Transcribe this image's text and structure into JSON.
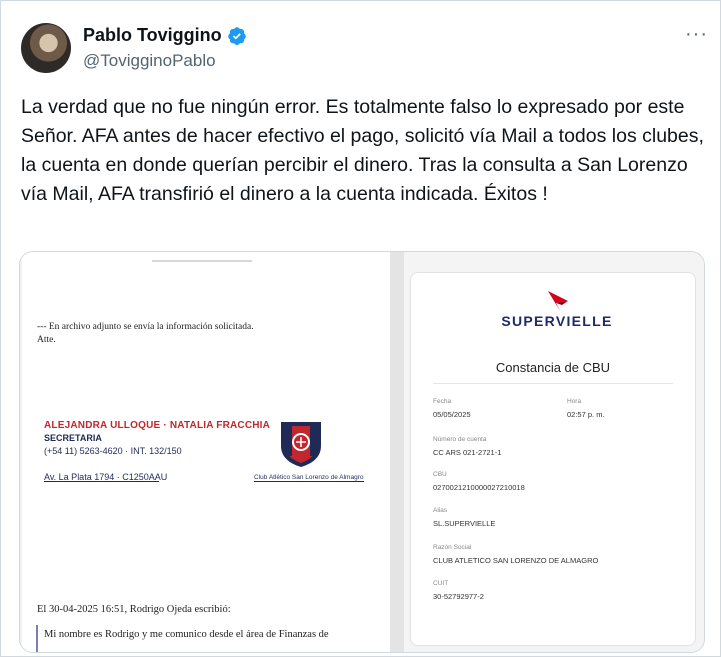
{
  "author": {
    "name": "Pablo Toviggino",
    "handle": "@TovigginoPablo",
    "verified_color": "#1d9bf0"
  },
  "more_icon_label": "···",
  "tweet": {
    "text": "La verdad que no fue ningún error. Es totalmente falso lo expresado por este Señor. AFA antes de hacer efectivo el pago, solicitó vía Mail a todos los clubes, la cuenta en donde querían percibir el dinero. Tras la consulta a San Lorenzo vía Mail, AFA transfirió el dinero a la cuenta indicada. Éxitos !"
  },
  "media": {
    "email_doc": {
      "line1": "--- En archivo adjunto se envía la información solicitada.",
      "line2": "Atte.",
      "signature_name": "ALEJANDRA ULLOQUE · NATALIA FRACCHIA",
      "signature_role": "SECRETARIA",
      "signature_phone": "(+54 11) 5263-4620 · INT. 132/150",
      "signature_address": "Av. La Plata 1794 · C1250AAU",
      "club_name": "Club Atlético San Lorenzo de Almagro",
      "reply_header": "El 30-04-2025 16:51, Rodrigo Ojeda escribió:",
      "reply_text": "Mi nombre es Rodrigo y me comunico desde el área de Finanzas de"
    },
    "cbu_doc": {
      "bank": "SUPERVIELLE",
      "title": "Constancia de CBU",
      "fecha_label": "Fecha",
      "fecha_value": "05/05/2025",
      "hora_label": "Hora",
      "hora_value": "02:57 p. m.",
      "cuenta_label": "Número de cuenta",
      "cuenta_value": "CC ARS 021-2721-1",
      "cbu_label": "CBU",
      "cbu_value": "0270021210000027210018",
      "alias_label": "Alias",
      "alias_value": "SL.SUPERVIELLE",
      "razon_label": "Razón Social",
      "razon_value": "CLUB ATLETICO SAN LORENZO DE ALMAGRO",
      "cuit_label": "CUIT",
      "cuit_value": "30-52792977-2"
    }
  },
  "colors": {
    "signature_red": "#c1272d",
    "signature_navy": "#1f2a57",
    "bank_red": "#d6001c",
    "bank_navy": "#1e2a6b"
  }
}
